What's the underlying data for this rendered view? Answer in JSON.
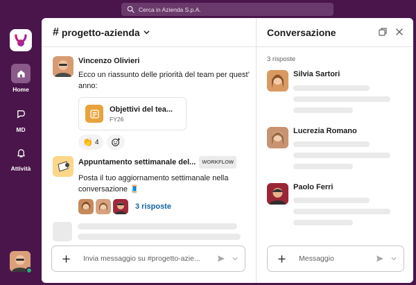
{
  "search": {
    "placeholder": "Cerca in Azienda S.p.A."
  },
  "rail": {
    "items": [
      {
        "label": "Home"
      },
      {
        "label": "MD"
      },
      {
        "label": "Attività"
      }
    ]
  },
  "channel": {
    "name": "progetto-azienda",
    "messages": [
      {
        "author": "Vincenzo Olivieri",
        "text": "Ecco un riassunto delle priorità del team per quest’ anno:",
        "file": {
          "title": "Objettivi del tea...",
          "subtitle": "FY26"
        },
        "reaction_count": "4"
      },
      {
        "author": "Appuntamento settimanale del...",
        "badge": "WORKFLOW",
        "text": "Posta il tuo aggiornamento settimanale nella conversazione 🧵",
        "replies": "3 risposte"
      }
    ],
    "composer_placeholder": "Invia messaggio su #progetto-azie..."
  },
  "thread": {
    "title": "Conversazione",
    "reply_count": "3 risposte",
    "participants": [
      {
        "name": "Silvia Sartori"
      },
      {
        "name": "Lucrezia Romano"
      },
      {
        "name": "Paolo Ferri"
      }
    ],
    "composer_placeholder": "Messaggio"
  },
  "colors": {
    "aubergine": "#4a154b",
    "link": "#1264a3",
    "presence": "#2bac76",
    "file_icon": "#e8a33d"
  }
}
